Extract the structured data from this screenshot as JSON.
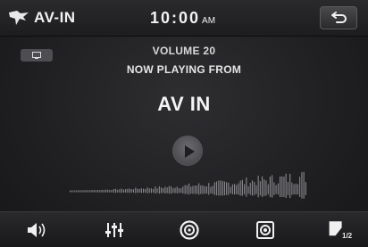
{
  "header": {
    "source_title": "AV-IN",
    "clock_time": "10:00",
    "clock_ampm": "AM"
  },
  "main": {
    "volume_text": "VOLUME 20",
    "now_playing_text": "NOW PLAYING FROM",
    "source_name": "AV IN"
  },
  "bottom_bar": {
    "page_indicator": "1/2",
    "buttons": [
      {
        "icon": "speaker-volume-icon"
      },
      {
        "icon": "equalizer-icon"
      },
      {
        "icon": "disc-icon"
      },
      {
        "icon": "camera-record-icon"
      },
      {
        "icon": "page-corner-icon"
      }
    ]
  },
  "colors": {
    "background": "#1f1f22",
    "text": "#f2f2f2",
    "waveform": "#8a8a8e"
  }
}
